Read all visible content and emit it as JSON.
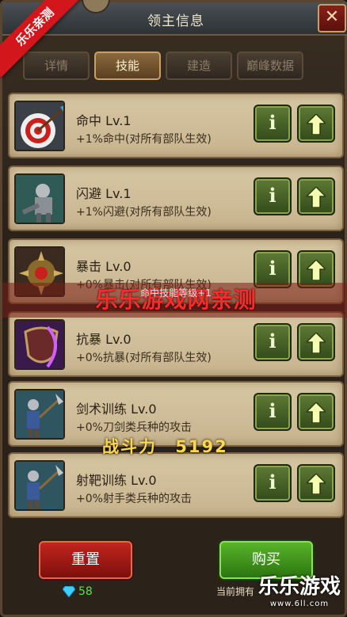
{
  "window": {
    "title": "领主信息",
    "close_label": "✕"
  },
  "ribbon": "乐乐亲测",
  "tabs": [
    {
      "label": "详情",
      "active": false
    },
    {
      "label": "技能",
      "active": true
    },
    {
      "label": "建造",
      "active": false
    },
    {
      "label": "巅峰数据",
      "active": false
    }
  ],
  "skills": [
    {
      "name": "命中 Lv.1",
      "desc": "+1%命中(对所有部队生效)",
      "icon": "target-arrows-icon"
    },
    {
      "name": "闪避 Lv.1",
      "desc": "+1%闪避(对所有部队生效)",
      "icon": "knight-dodge-icon"
    },
    {
      "name": "暴击 Lv.0",
      "desc": "+0%暴击(对所有部队生效)",
      "icon": "spiked-fist-icon"
    },
    {
      "name": "抗暴 Lv.0",
      "desc": "+0%抗暴(对所有部队生效)",
      "icon": "shield-resist-icon"
    },
    {
      "name": "剑术训练 Lv.0",
      "desc": "+0%刀剑类兵种的攻击",
      "icon": "swordsman-icon"
    },
    {
      "name": "射靶训练 Lv.0",
      "desc": "+0%射手类兵种的攻击",
      "icon": "archer-icon"
    }
  ],
  "info_button_label": "i",
  "overlay": {
    "watermark": "乐乐游戏网亲测",
    "tip": "命中技能等级+1",
    "combat_label": "战斗力",
    "combat_value": "5192"
  },
  "footer": {
    "reset_label": "重置",
    "buy_label": "购买",
    "gem_count": "58",
    "owned_text": "当前拥有",
    "logo_text": "乐乐游戏",
    "logo_site": "www.6ll.com"
  },
  "colors": {
    "reset": "#c2251d",
    "buy": "#58b52a",
    "gem": "#5fe04e",
    "combat": "#ffd84a"
  }
}
